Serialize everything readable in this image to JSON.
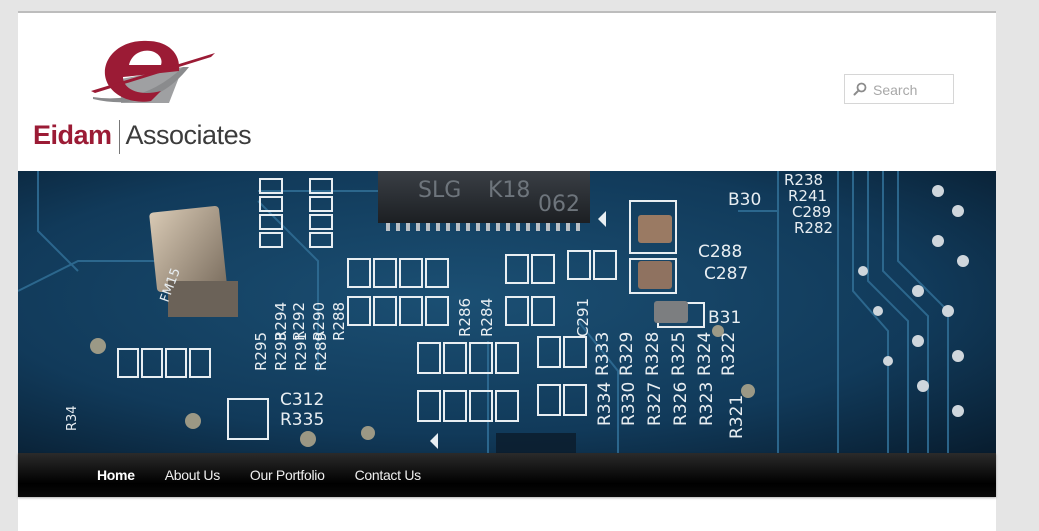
{
  "brand": {
    "name_primary": "Eidam",
    "name_secondary": "Associates",
    "colors": {
      "primary": "#9b1b35",
      "secondary": "#3c3c3c",
      "logo_gray": "#9fa0a2"
    }
  },
  "search": {
    "placeholder": "Search",
    "value": "",
    "icon": "search-icon"
  },
  "hero": {
    "description_icon": "circuit-board-photo",
    "silkscreen": {
      "top_right": [
        "R238",
        "R241",
        "C289",
        "R282"
      ],
      "chip_text": [
        "SLG",
        "K18",
        "062"
      ],
      "right_labels": [
        "B30",
        "C288",
        "C287",
        "B31"
      ],
      "vertical_mid": [
        "R286",
        "R284",
        "C291"
      ],
      "vertical_left": [
        "R295",
        "R294",
        "R293",
        "R292",
        "R291",
        "R290",
        "R289",
        "R288"
      ],
      "vertical_bottom": [
        "R333",
        "R334",
        "R329",
        "R330",
        "R328",
        "R327",
        "R325",
        "R326",
        "R324",
        "R323",
        "R322",
        "R321"
      ],
      "left_bottom": [
        "C312",
        "R335"
      ],
      "misc": [
        "FM15",
        "R34"
      ]
    }
  },
  "nav": {
    "items": [
      {
        "label": "Home",
        "active": true
      },
      {
        "label": "About Us",
        "active": false
      },
      {
        "label": "Our Portfolio",
        "active": false
      },
      {
        "label": "Contact Us",
        "active": false
      }
    ],
    "background": "#000000"
  }
}
